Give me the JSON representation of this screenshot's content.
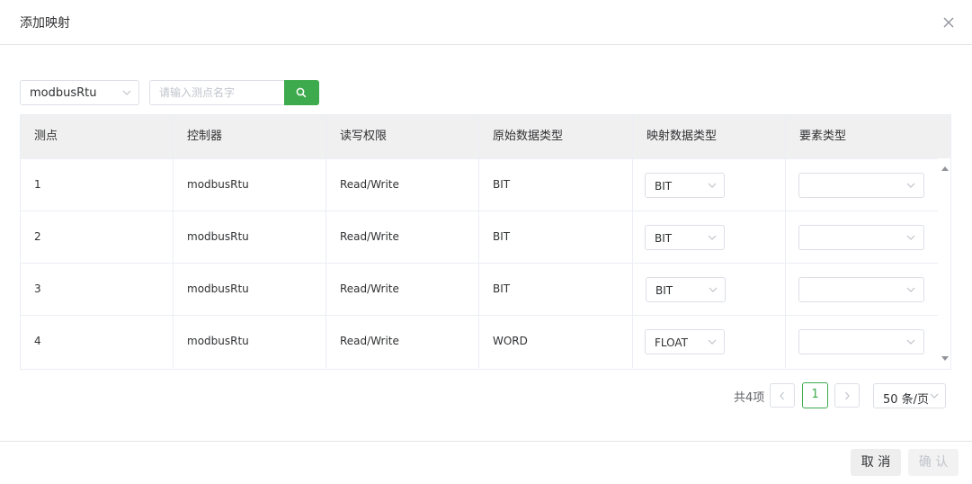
{
  "dialog": {
    "title": "添加映射"
  },
  "filters": {
    "controller_value": "modbusRtu",
    "search_placeholder": "请输入测点名字"
  },
  "table": {
    "columns": [
      "测点",
      "控制器",
      "读写权限",
      "原始数据类型",
      "映射数据类型",
      "要素类型"
    ],
    "rows": [
      {
        "point": "1",
        "controller": "modbusRtu",
        "access": "Read/Write",
        "raw_type": "BIT",
        "mapped_type": "BIT",
        "element_type": ""
      },
      {
        "point": "2",
        "controller": "modbusRtu",
        "access": "Read/Write",
        "raw_type": "BIT",
        "mapped_type": "BIT",
        "element_type": ""
      },
      {
        "point": "3",
        "controller": "modbusRtu",
        "access": "Read/Write",
        "raw_type": "BIT",
        "mapped_type": "BIT",
        "element_type": ""
      },
      {
        "point": "4",
        "controller": "modbusRtu",
        "access": "Read/Write",
        "raw_type": "WORD",
        "mapped_type": "FLOAT",
        "element_type": ""
      }
    ]
  },
  "pagination": {
    "total_label": "共4项",
    "current_page": "1",
    "page_size": "50 条/页"
  },
  "footer": {
    "cancel_label": "取 消",
    "confirm_label": "确 认"
  },
  "colors": {
    "accent": "#3daa4d",
    "header_bg": "#f0f0f0"
  }
}
